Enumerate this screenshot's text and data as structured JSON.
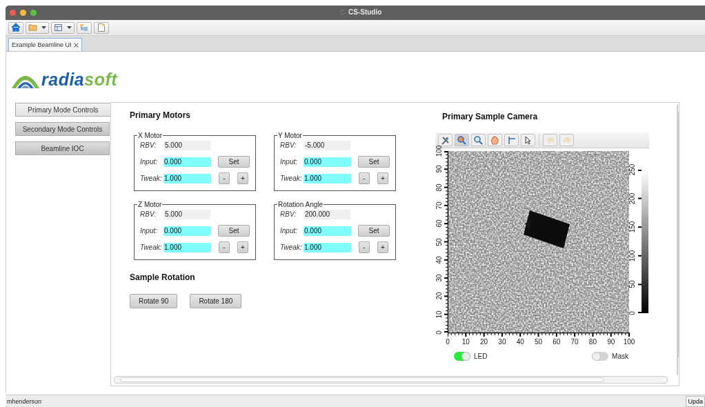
{
  "window": {
    "title": "CS-Studio"
  },
  "toolbar": [
    {
      "kind": "home",
      "dropdown": false
    },
    {
      "kind": "folder",
      "dropdown": true
    },
    {
      "kind": "layout",
      "dropdown": true
    },
    {
      "kind": "tree",
      "dropdown": false
    },
    {
      "kind": "note",
      "dropdown": false
    }
  ],
  "tabs": [
    {
      "label": "Example Beamline UI",
      "selected": true
    }
  ],
  "logo": {
    "part_1": "radia",
    "part_2": "soft"
  },
  "sidebar": {
    "items": [
      {
        "label": "Primary Mode Controls",
        "selected": true
      },
      {
        "label": "Secondary Mode Controls",
        "selected": false
      },
      {
        "label": "Beamline IOC",
        "selected": false
      }
    ]
  },
  "primary_motors": {
    "title": "Primary Motors",
    "motors": [
      {
        "title": "X Motor",
        "rows": [
          {
            "kind": "readback",
            "label": "RBV:",
            "value": "5.000"
          },
          {
            "kind": "input",
            "label": "Input:",
            "value": "0.000",
            "buttons": [
              "Set"
            ]
          },
          {
            "kind": "input",
            "label": "Tweak:",
            "value": "1.000",
            "buttons": [
              "-",
              "+"
            ]
          }
        ]
      },
      {
        "title": "Y Motor",
        "rows": [
          {
            "kind": "readback",
            "label": "RBV:",
            "value": "-5.000"
          },
          {
            "kind": "input",
            "label": "Input:",
            "value": "0.000",
            "buttons": [
              "Set"
            ]
          },
          {
            "kind": "input",
            "label": "Tweak:",
            "value": "1.000",
            "buttons": [
              "-",
              "+"
            ]
          }
        ]
      },
      {
        "title": "Z Motor",
        "rows": [
          {
            "kind": "readback",
            "label": "RBV:",
            "value": "5.000"
          },
          {
            "kind": "input",
            "label": "Input:",
            "value": "0.000",
            "buttons": [
              "Set"
            ]
          },
          {
            "kind": "input",
            "label": "Tweak:",
            "value": "1.000",
            "buttons": [
              "-",
              "+"
            ]
          }
        ]
      },
      {
        "title": "Rotation Angle",
        "rows": [
          {
            "kind": "readback",
            "label": "RBV:",
            "value": "200.000"
          },
          {
            "kind": "input",
            "label": "Input:",
            "value": "0.000",
            "buttons": [
              "Set"
            ]
          },
          {
            "kind": "input",
            "label": "Tweak:",
            "value": "1.000",
            "buttons": [
              "-",
              "+"
            ]
          }
        ]
      }
    ]
  },
  "sample_rotation": {
    "title": "Sample Rotation",
    "buttons": [
      "Rotate 90",
      "Rotate 180"
    ]
  },
  "camera": {
    "title": "Primary Sample Camera",
    "tools": [
      {
        "kind": "config",
        "selected": false,
        "disabled": false
      },
      {
        "kind": "zoom_in",
        "selected": true,
        "disabled": false
      },
      {
        "kind": "zoom_out",
        "selected": false,
        "disabled": false
      },
      {
        "kind": "pan",
        "selected": false,
        "disabled": false
      },
      {
        "kind": "crosshair",
        "selected": false,
        "disabled": false
      },
      {
        "kind": "pointer",
        "selected": false,
        "disabled": false
      },
      {
        "kind": "undo",
        "selected": false,
        "disabled": true
      },
      {
        "kind": "redo",
        "selected": false,
        "disabled": true
      }
    ],
    "y_ticks": [
      "0",
      "10",
      "20",
      "30",
      "40",
      "50",
      "60",
      "70",
      "80",
      "90",
      "100"
    ],
    "x_ticks": [
      "0",
      "10",
      "20",
      "30",
      "40",
      "50",
      "60",
      "70",
      "80",
      "90",
      "100"
    ],
    "colorbar_ticks": [
      "0",
      "50",
      "100",
      "150",
      "200",
      "250"
    ],
    "toggles": [
      {
        "label": "LED",
        "on": true
      },
      {
        "label": "Mask",
        "on": false
      }
    ]
  },
  "status_bar": {
    "user": "mhenderson",
    "button": "Upda"
  }
}
